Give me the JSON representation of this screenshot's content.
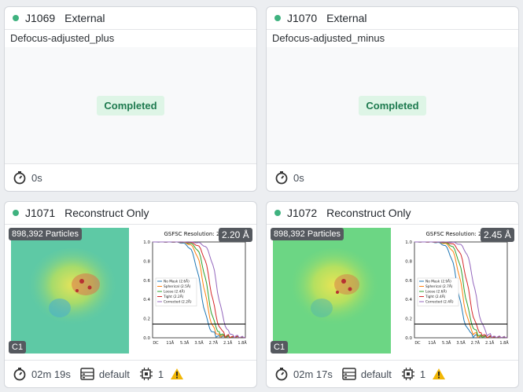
{
  "cards": [
    {
      "id": "J1069",
      "type": "External",
      "title": "Defocus-adjusted_plus",
      "status": "Completed",
      "duration": "0s"
    },
    {
      "id": "J1070",
      "type": "External",
      "title": "Defocus-adjusted_minus",
      "status": "Completed",
      "duration": "0s"
    },
    {
      "id": "J1071",
      "type": "Reconstruct Only",
      "particles": "898,392 Particles",
      "symmetry": "C1",
      "fsc_resolution": "2.20 Å",
      "duration": "02m 19s",
      "lane": "default",
      "gpus": "1",
      "chart_data": {
        "type": "line",
        "title": "GSFSC Resolution: 2.20 Å",
        "x_tick_labels": [
          "DC",
          "11Å",
          "5.3Å",
          "3.5Å",
          "2.7Å",
          "2.1Å",
          "1.8Å"
        ],
        "y_tick_labels": [
          "0.0",
          "0.2",
          "0.4",
          "0.6",
          "0.8",
          "1.0"
        ],
        "ylim": [
          0,
          1
        ],
        "threshold": 0.143,
        "legend": [
          "No Mask (2.6Å)",
          "Spherical (2.5Å)",
          "Loose (2.4Å)",
          "Tight (2.2Å)",
          "Corrected (2.2Å)"
        ],
        "series_colors": [
          "#1f77b4",
          "#ff7f0e",
          "#2ca02c",
          "#d62728",
          "#9467bd"
        ],
        "midpoints": [
          0.52,
          0.56,
          0.59,
          0.63,
          0.7
        ]
      }
    },
    {
      "id": "J1072",
      "type": "Reconstruct Only",
      "particles": "898,392 Particles",
      "symmetry": "C1",
      "fsc_resolution": "2.45 Å",
      "duration": "02m 17s",
      "lane": "default",
      "gpus": "1",
      "chart_data": {
        "type": "line",
        "title": "GSFSC Resolution: 2.45 Å",
        "x_tick_labels": [
          "DC",
          "11Å",
          "5.3Å",
          "3.5Å",
          "2.7Å",
          "2.1Å",
          "1.8Å"
        ],
        "y_tick_labels": [
          "0.0",
          "0.2",
          "0.4",
          "0.6",
          "0.8",
          "1.0"
        ],
        "ylim": [
          0,
          1
        ],
        "threshold": 0.143,
        "legend": [
          "No Mask (2.9Å)",
          "Spherical (2.7Å)",
          "Loose (2.6Å)",
          "Tight (2.4Å)",
          "Corrected (2.4Å)"
        ],
        "series_colors": [
          "#1f77b4",
          "#ff7f0e",
          "#2ca02c",
          "#d62728",
          "#9467bd"
        ],
        "midpoints": [
          0.47,
          0.51,
          0.54,
          0.58,
          0.65
        ]
      }
    }
  ]
}
